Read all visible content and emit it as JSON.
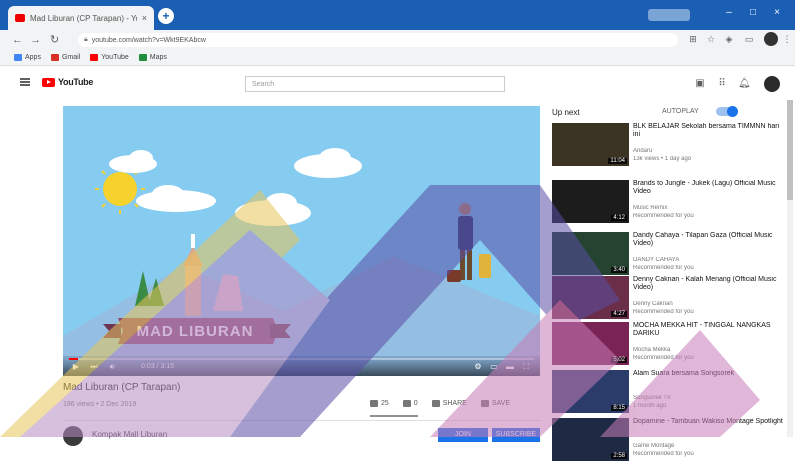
{
  "browser": {
    "tab_title": "Mad Liburan (CP Tarapan) - YouTube",
    "tab_close": "×",
    "new_tab": "+",
    "url": "youtube.com/watch?v=Wkt9EKAbcw",
    "bookmarks": [
      {
        "label": "Apps",
        "color": "#4285f4"
      },
      {
        "label": "Gmail",
        "color": "#d93025"
      },
      {
        "label": "YouTube",
        "color": "#ff0000"
      },
      {
        "label": "Maps",
        "color": "#1e8e3e"
      }
    ],
    "window_controls": [
      "–",
      "□",
      "×"
    ]
  },
  "youtube": {
    "logo_text": "YouTube",
    "search_placeholder": "Search"
  },
  "video": {
    "scene_text": "MAD LIBURAN",
    "timecode": "0:03 / 3:15",
    "progress": 0.02,
    "title": "Mad Liburan (CP Tarapan)",
    "meta": "186 views • 2 Dec 2019",
    "likes": "25",
    "dislikes": "0",
    "share_label": "SHARE",
    "save_label": "SAVE",
    "channel_name": "Kompak Mall Liburan",
    "join_label": "JOIN",
    "subscribe_label": "SUBSCRIBE"
  },
  "sidebar": {
    "up_next": "Up next",
    "autoplay": "AUTOPLAY",
    "recommendations": [
      {
        "title": "BLK BELAJAR Sekolah bersama TIMMNN hari ini",
        "channel": "Andaru",
        "views": "13k views • 1 day ago",
        "duration": "11:04",
        "color": "#3b3324"
      },
      {
        "title": "Brands to Jungle - Jukek (Lagu) Official Music Video",
        "channel": "Music Remix",
        "views": "Recommended for you",
        "duration": "4:12",
        "color": "#1c1c1c"
      },
      {
        "title": "Dandy Cahaya - Tilapan Gaza (Official Music Video)",
        "channel": "DANDY CAHAYA",
        "views": "Recommended for you",
        "duration": "3:40",
        "color": "#244431"
      },
      {
        "title": "Denny Caknan - Kalah Menang (Official Music Video)",
        "channel": "Denny Caknan",
        "views": "Recommended for you",
        "duration": "4:27",
        "color": "#6a2e48"
      },
      {
        "title": "MOCHA MEKKA HIT - TINGGAL NANGKAS DARIKU",
        "channel": "Mocha Mekka",
        "views": "Recommended for you",
        "duration": "5:02",
        "color": "#7a2456"
      },
      {
        "title": "Alam Suara bersama Songsorek",
        "channel": "Songsorek TV",
        "views": "1 month ago",
        "duration": "8:15",
        "color": "#2b3c6a"
      },
      {
        "title": "Dopamine - Tambuan Wakiso Montage Spotlight",
        "channel": "Game Montage",
        "views": "Recommended for you",
        "duration": "2:58",
        "color": "#1e2a44"
      }
    ]
  }
}
